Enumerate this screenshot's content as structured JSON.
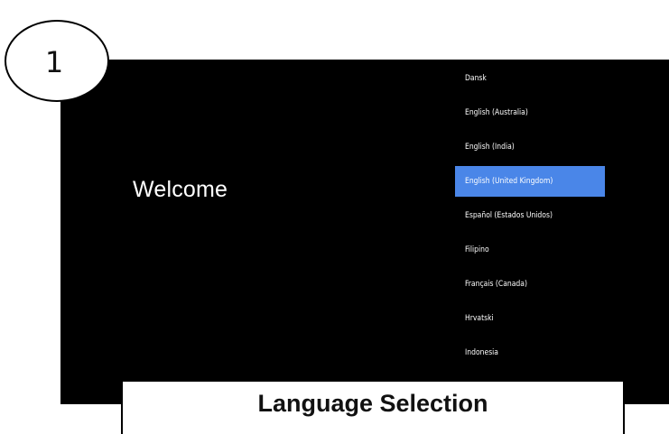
{
  "step": {
    "number": "1"
  },
  "screen": {
    "welcome_text": "Welcome",
    "languages": [
      {
        "label": "Dansk",
        "selected": false
      },
      {
        "label": "English (Australia)",
        "selected": false
      },
      {
        "label": "English (India)",
        "selected": false
      },
      {
        "label": "English (United Kingdom)",
        "selected": true
      },
      {
        "label": "Español (Estados Unidos)",
        "selected": false
      },
      {
        "label": "Filipino",
        "selected": false
      },
      {
        "label": "Français (Canada)",
        "selected": false
      },
      {
        "label": "Hrvatski",
        "selected": false
      },
      {
        "label": "Indonesia",
        "selected": false
      }
    ]
  },
  "caption": {
    "text": "Language Selection"
  },
  "colors": {
    "selection": "#4a86e8",
    "screen_bg": "#000000"
  }
}
